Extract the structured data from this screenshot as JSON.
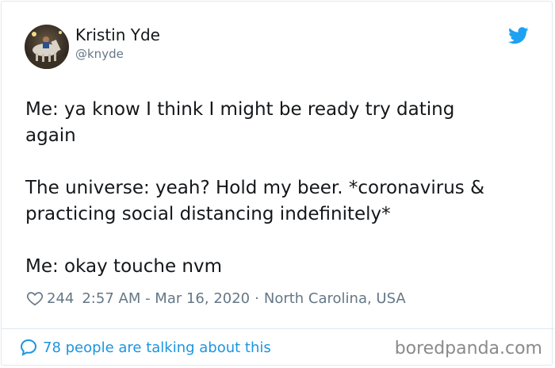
{
  "author": {
    "name": "Kristin Yde",
    "handle": "@knyde"
  },
  "tweet": {
    "lines": [
      "Me: ya know I think I might be ready try dating",
      "again",
      "The universe: yeah? Hold my beer. *coronavirus &",
      "practicing social distancing indefinitely*",
      "Me: okay touche nvm"
    ]
  },
  "meta": {
    "likes": "244",
    "timestamp": "2:57 AM - Mar 16, 2020",
    "separator": "·",
    "location": "North Carolina, USA"
  },
  "footer": {
    "talking": "78 people are talking about this",
    "watermark": "boredpanda.com"
  },
  "icons": {
    "logo": "twitter-bird-icon",
    "like": "heart-icon",
    "reply": "speech-bubble-icon"
  },
  "colors": {
    "twitter_blue": "#1da1f2",
    "link_blue": "#1b95e0",
    "muted_text": "#657786",
    "border": "#e1e8ed"
  }
}
